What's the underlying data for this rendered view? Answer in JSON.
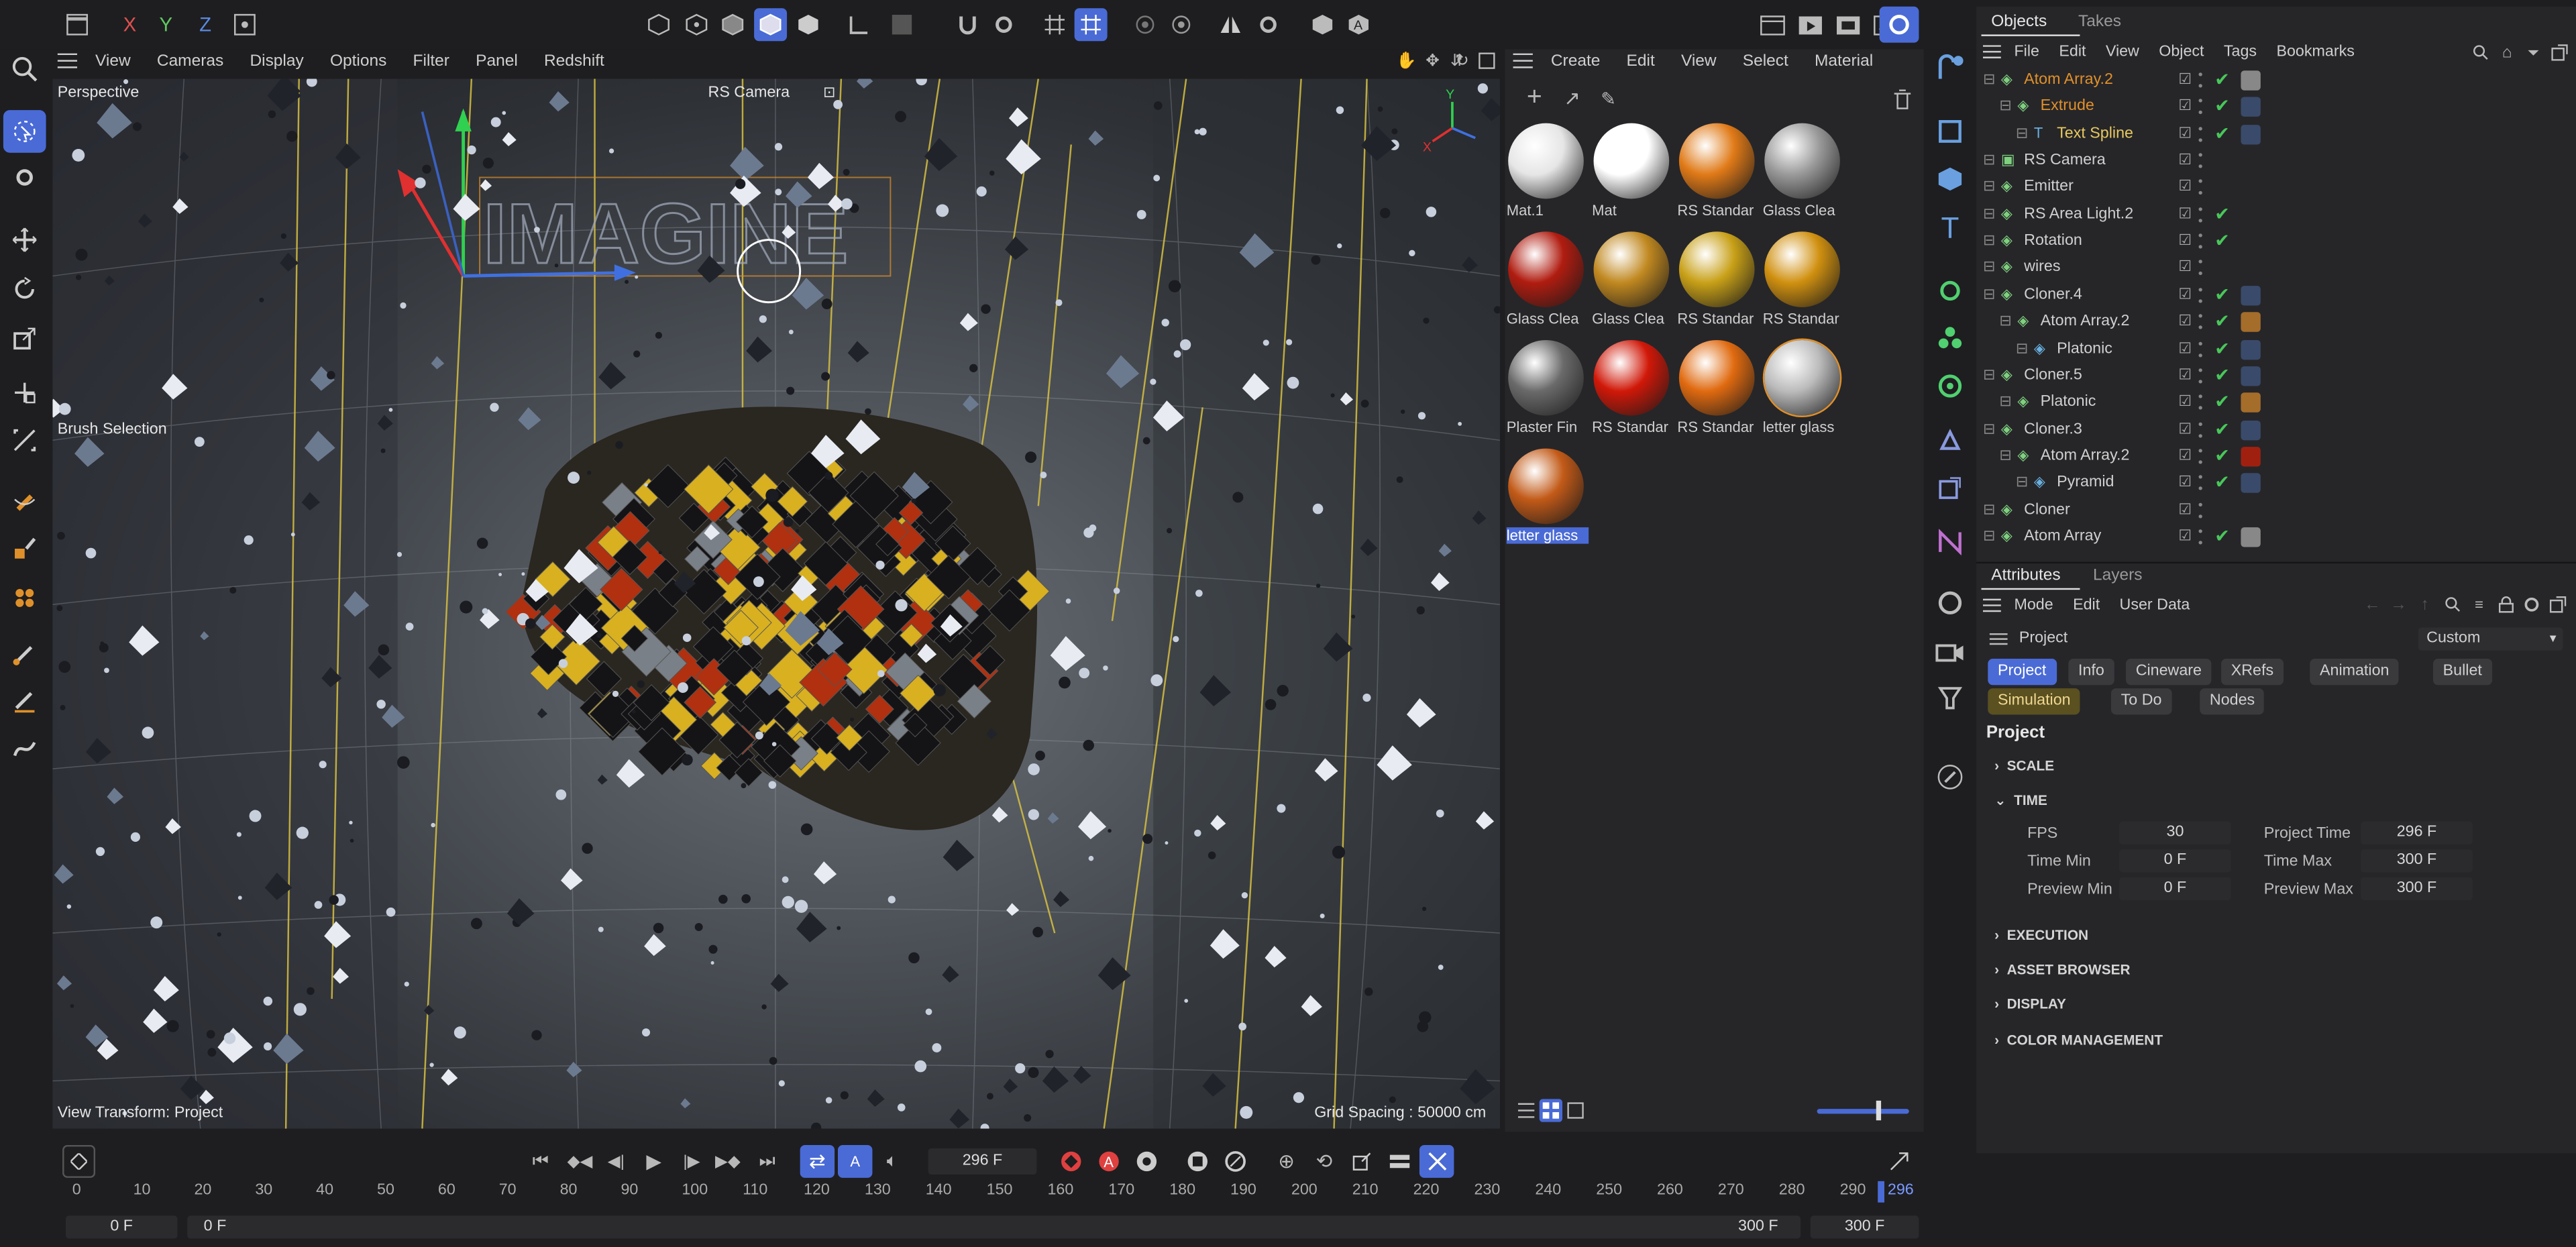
{
  "colors": {
    "accent": "#4a6bd6",
    "orange": "#e0902a",
    "check": "#49c75a",
    "yellow": "#e8c860"
  },
  "top_toolbar": {
    "axis_x": "X",
    "axis_y": "Y",
    "axis_z": "Z"
  },
  "viewport": {
    "menu": [
      "View",
      "Cameras",
      "Display",
      "Options",
      "Filter",
      "Panel",
      "Redshift"
    ],
    "label": "Perspective",
    "camera": "RS Camera",
    "brush_selection": "Brush Selection",
    "view_transform": "View Transform: Project",
    "grid_spacing": "Grid Spacing : 50000 cm",
    "text_object": "IMAGINE"
  },
  "material_manager": {
    "menu": [
      "Create",
      "Edit",
      "View",
      "Select",
      "Material"
    ],
    "materials": [
      {
        "name": "Mat.1",
        "color": "#e6e6e6"
      },
      {
        "name": "Mat",
        "color": "#ffffff"
      },
      {
        "name": "RS Standar",
        "color": "#e07a18"
      },
      {
        "name": "Glass Clea",
        "color": "#9a9a9a"
      },
      {
        "name": "Glass Clea",
        "color": "#b01c10"
      },
      {
        "name": "Glass Clea",
        "color": "#c08820"
      },
      {
        "name": "RS Standar",
        "color": "#c8a018"
      },
      {
        "name": "RS Standar",
        "color": "#d09010"
      },
      {
        "name": "Plaster Fin",
        "color": "#6a6a6a"
      },
      {
        "name": "RS Standar",
        "color": "#d01808"
      },
      {
        "name": "RS Standar",
        "color": "#e06a10"
      },
      {
        "name": "letter glass",
        "color": "#bbbbbb"
      },
      {
        "name": "letter glass",
        "color": "#c25a18"
      }
    ]
  },
  "objects_panel": {
    "tabs": [
      "Objects",
      "Takes"
    ],
    "menu": [
      "File",
      "Edit",
      "View",
      "Object",
      "Tags",
      "Bookmarks"
    ],
    "rows": [
      {
        "name": "Atom Array.2",
        "indent": 0,
        "color": "#e0902a",
        "check": true
      },
      {
        "name": "Extrude",
        "indent": 1,
        "color": "#e0902a",
        "check": true
      },
      {
        "name": "Text Spline",
        "indent": 2,
        "color": "#e8c860",
        "check": true
      },
      {
        "name": "RS Camera",
        "indent": 0,
        "color": "#d0d0d0",
        "check": false
      },
      {
        "name": "Emitter",
        "indent": 0,
        "color": "#d0d0d0",
        "check": false
      },
      {
        "name": "RS Area Light.2",
        "indent": 0,
        "color": "#d0d0d0",
        "check": true
      },
      {
        "name": "Rotation",
        "indent": 0,
        "color": "#d0d0d0",
        "check": true
      },
      {
        "name": "wires",
        "indent": 0,
        "color": "#d0d0d0",
        "check": false
      },
      {
        "name": "Cloner.4",
        "indent": 0,
        "color": "#d0d0d0",
        "check": true
      },
      {
        "name": "Atom Array.2",
        "indent": 1,
        "color": "#d0d0d0",
        "check": true
      },
      {
        "name": "Platonic",
        "indent": 2,
        "color": "#d0d0d0",
        "check": true
      },
      {
        "name": "Cloner.5",
        "indent": 0,
        "color": "#d0d0d0",
        "check": true
      },
      {
        "name": "Platonic",
        "indent": 1,
        "color": "#d0d0d0",
        "check": true
      },
      {
        "name": "Cloner.3",
        "indent": 0,
        "color": "#d0d0d0",
        "check": true
      },
      {
        "name": "Atom Array.2",
        "indent": 1,
        "color": "#d0d0d0",
        "check": true
      },
      {
        "name": "Pyramid",
        "indent": 2,
        "color": "#d0d0d0",
        "check": true
      },
      {
        "name": "Cloner",
        "indent": 0,
        "color": "#d0d0d0",
        "check": false
      },
      {
        "name": "Atom Array",
        "indent": 0,
        "color": "#d0d0d0",
        "check": true
      }
    ]
  },
  "attributes": {
    "tabs": [
      "Attributes",
      "Layers"
    ],
    "menu": [
      "Mode",
      "Edit",
      "User Data"
    ],
    "project_label": "Project",
    "dropdown": "Custom",
    "chips_row1": [
      "Project",
      "Info",
      "Cineware",
      "XRefs",
      "Animation",
      "Bullet"
    ],
    "chips_row2": [
      "Simulation",
      "To Do",
      "Nodes"
    ],
    "heading": "Project",
    "sections": [
      "SCALE",
      "TIME",
      "EXECUTION",
      "ASSET BROWSER",
      "DISPLAY",
      "COLOR MANAGEMENT"
    ],
    "time": {
      "fps_label": "FPS",
      "fps": "30",
      "project_time_label": "Project Time",
      "project_time": "296 F",
      "time_min_label": "Time Min",
      "time_min": "0 F",
      "time_max_label": "Time Max",
      "time_max": "300 F",
      "preview_min_label": "Preview Min",
      "preview_min": "0 F",
      "preview_max_label": "Preview Max",
      "preview_max": "300 F"
    }
  },
  "timeline": {
    "current_frame": "296 F",
    "ticks": [
      "0",
      "10",
      "20",
      "30",
      "40",
      "50",
      "60",
      "70",
      "80",
      "90",
      "100",
      "110",
      "120",
      "130",
      "140",
      "150",
      "160",
      "170",
      "180",
      "190",
      "200",
      "210",
      "220",
      "230",
      "240",
      "250",
      "260",
      "270",
      "280",
      "290"
    ],
    "playhead": "296",
    "start": "0 F",
    "range_start": "0 F",
    "range_end": "300 F",
    "end": "300 F"
  }
}
